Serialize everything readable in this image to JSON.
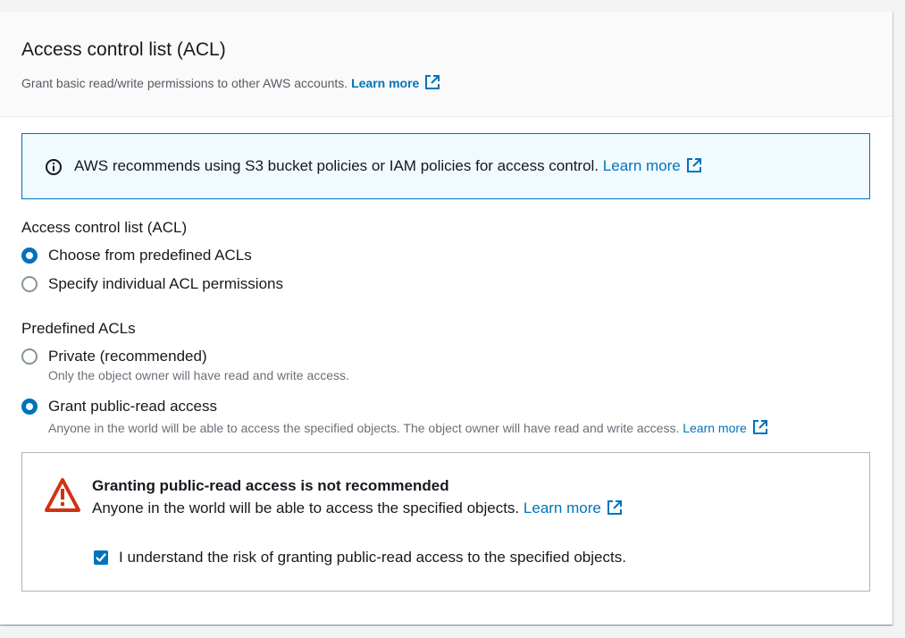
{
  "header": {
    "title": "Access control list (ACL)",
    "description": "Grant basic read/write permissions to other AWS accounts.",
    "learn_more": "Learn more"
  },
  "info_alert": {
    "icon": "info-circle-icon",
    "text": "AWS recommends using S3 bucket policies or IAM policies for access control.",
    "learn_more": "Learn more"
  },
  "acl_choice": {
    "label": "Access control list (ACL)",
    "options": [
      {
        "label": "Choose from predefined ACLs",
        "checked": true
      },
      {
        "label": "Specify individual ACL permissions",
        "checked": false
      }
    ]
  },
  "predefined": {
    "label": "Predefined ACLs",
    "options": [
      {
        "label": "Private (recommended)",
        "description": "Only the object owner will have read and write access.",
        "checked": false
      },
      {
        "label": "Grant public-read access",
        "description": "Anyone in the world will be able to access the specified objects. The object owner will have read and write access.",
        "learn_more": "Learn more",
        "checked": true
      }
    ]
  },
  "warning": {
    "icon": "warning-triangle-icon",
    "title": "Granting public-read access is not recommended",
    "text": "Anyone in the world will be able to access the specified objects.",
    "learn_more": "Learn more",
    "checkbox_label": "I understand the risk of granting public-read access to the specified objects.",
    "checkbox_checked": true
  },
  "colors": {
    "link": "#0073bb",
    "warning": "#d13212",
    "info_bg": "#f1faff"
  }
}
